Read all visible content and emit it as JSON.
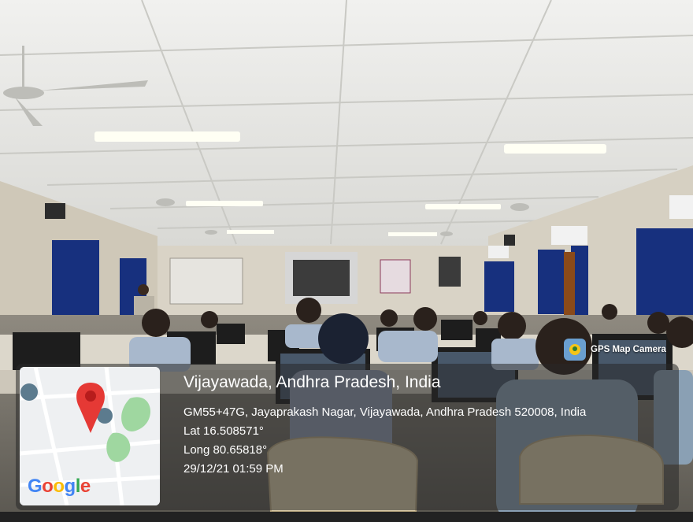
{
  "badge": {
    "label": "GPS Map Camera",
    "icon": "camera-pin-icon"
  },
  "map": {
    "logo": [
      "G",
      "o",
      "o",
      "g",
      "l",
      "e"
    ],
    "logo_colors": [
      "#4285F4",
      "#EA4335",
      "#FBBC05",
      "#4285F4",
      "#34A853",
      "#EA4335"
    ]
  },
  "location": {
    "city": "Vijayawada, Andhra Pradesh, India",
    "address": "GM55+47G, Jayaprakash Nagar, Vijayawada, Andhra Pradesh 520008, India",
    "lat": "Lat 16.508571°",
    "long": "Long 80.65818°",
    "timestamp": "29/12/21 01:59 PM"
  },
  "colors": {
    "curtain": "#17307e",
    "wall": "#d9d3c6",
    "ceiling": "#ececea",
    "pin": "#e53935"
  }
}
